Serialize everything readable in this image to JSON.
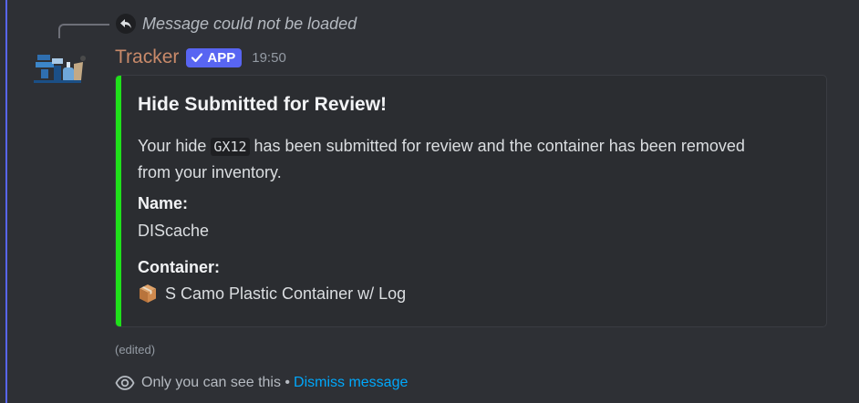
{
  "reply": {
    "text": "Message could not be loaded",
    "icon": "reply-arrow-icon"
  },
  "author": {
    "name": "Tracker",
    "badge": "APP",
    "timestamp": "19:50",
    "name_color": "#c98a6a"
  },
  "embed": {
    "accent_color": "#1fe01a",
    "title": "Hide Submitted for Review!",
    "desc_before": "Your hide ",
    "desc_code": "GX12",
    "desc_after": " has been submitted for review and the container has been removed from your inventory.",
    "fields": [
      {
        "name": "Name:",
        "value": "DIScache"
      },
      {
        "name": "Container:",
        "value": "S Camo Plastic Container w/ Log",
        "icon": "package-icon"
      }
    ]
  },
  "edited_label": "(edited)",
  "ephemeral": {
    "text": "Only you can see this • ",
    "dismiss_label": "Dismiss message",
    "icon": "eye-icon"
  }
}
